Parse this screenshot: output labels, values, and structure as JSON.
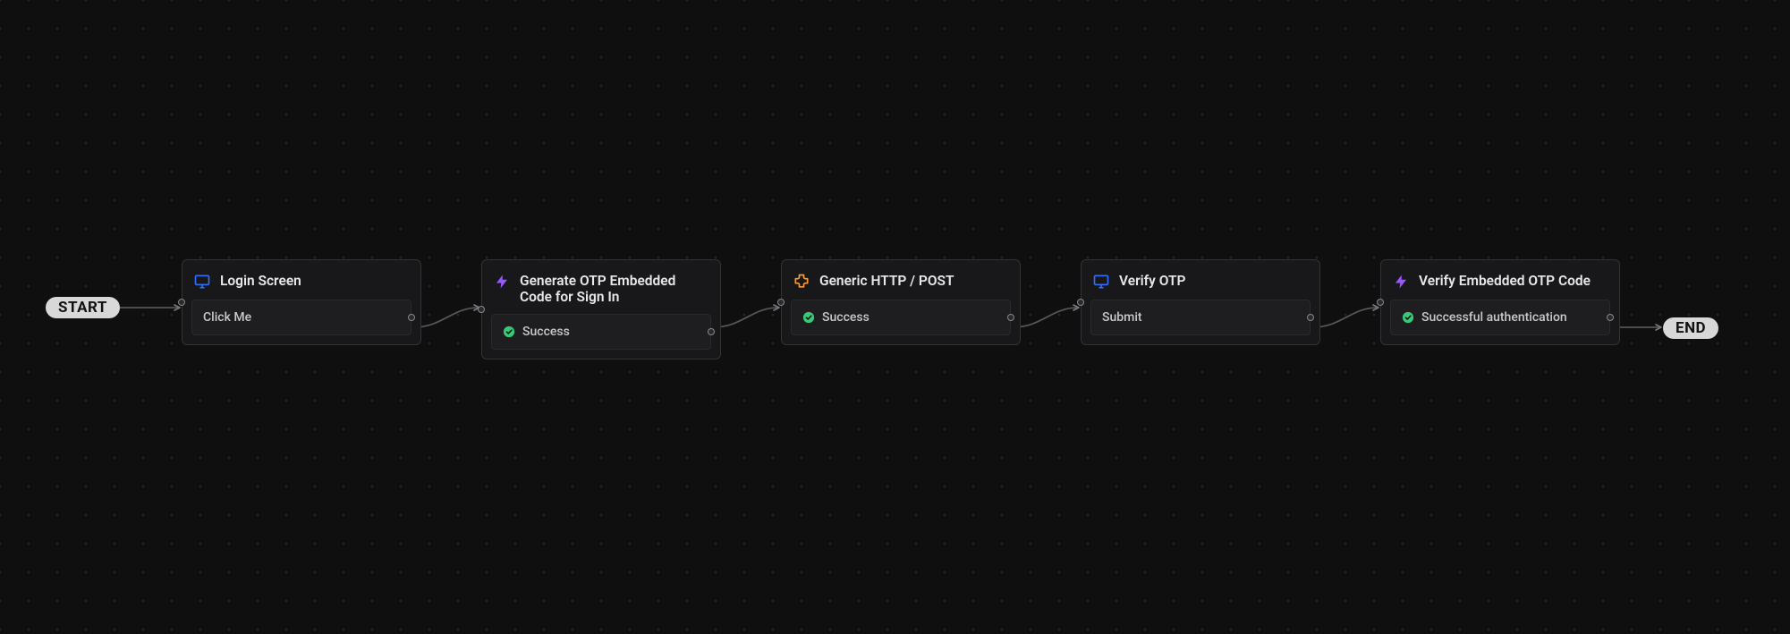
{
  "pills": {
    "start": "START",
    "end": "END"
  },
  "nodes": [
    {
      "icon": "screen",
      "title": "Login Screen",
      "row": {
        "status": null,
        "label": "Click Me"
      }
    },
    {
      "icon": "bolt",
      "title": "Generate OTP Embedded Code for Sign In",
      "row": {
        "status": "success",
        "label": "Success"
      }
    },
    {
      "icon": "extension",
      "title": "Generic HTTP / POST",
      "row": {
        "status": "success",
        "label": "Success"
      }
    },
    {
      "icon": "screen",
      "title": "Verify OTP",
      "row": {
        "status": null,
        "label": "Submit"
      }
    },
    {
      "icon": "bolt",
      "title": "Verify Embedded OTP Code",
      "row": {
        "status": "success",
        "label": "Successful authentication"
      }
    }
  ]
}
